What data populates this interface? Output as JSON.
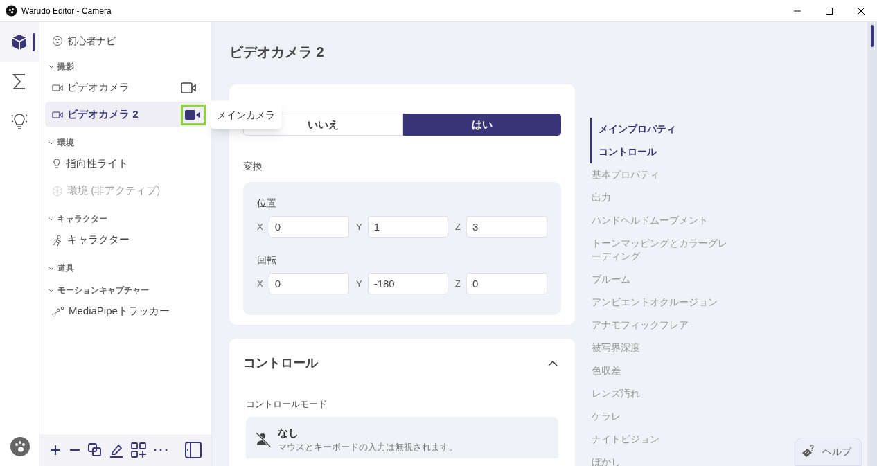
{
  "window": {
    "title": "Warudo Editor - Camera"
  },
  "rail": [
    {
      "kind": "cube",
      "selected": true
    },
    {
      "kind": "sigma",
      "selected": false
    },
    {
      "kind": "bulb",
      "selected": false
    }
  ],
  "tree": {
    "guide": "初心者ナビ",
    "groups": [
      {
        "label": "撮影",
        "expanded": true,
        "items": [
          {
            "label": "ビデオカメラ",
            "kind": "camera",
            "selected": false,
            "disabled": false,
            "main_camera": false
          },
          {
            "label": "ビデオカメラ 2",
            "kind": "camera",
            "selected": true,
            "disabled": false,
            "main_camera": true
          }
        ]
      },
      {
        "label": "環境",
        "expanded": true,
        "items": [
          {
            "label": "指向性ライト",
            "kind": "light",
            "selected": false,
            "disabled": false
          },
          {
            "label": "環境 (非アクティブ)",
            "kind": "environment",
            "selected": false,
            "disabled": true
          }
        ]
      },
      {
        "label": "キャラクター",
        "expanded": true,
        "items": [
          {
            "label": "キャラクター",
            "kind": "character",
            "selected": false,
            "disabled": false
          }
        ]
      },
      {
        "label": "道具",
        "expanded": true
      },
      {
        "label": "モーションキャプチャー",
        "expanded": true,
        "items": [
          {
            "label": "MediaPipeトラッカー",
            "kind": "tracker",
            "selected": false,
            "disabled": false
          }
        ]
      }
    ]
  },
  "tooltip": "メインカメラ",
  "main": {
    "title": "ビデオカメラ 2",
    "toggle": [
      {
        "label": "いいえ",
        "selected": false
      },
      {
        "label": "はい",
        "selected": true
      }
    ],
    "transform": {
      "label": "変換",
      "groups": [
        {
          "label": "位置",
          "fields": [
            {
              "axis": "X",
              "value": "0"
            },
            {
              "axis": "Y",
              "value": "1"
            },
            {
              "axis": "Z",
              "value": "3"
            }
          ]
        },
        {
          "label": "回転",
          "fields": [
            {
              "axis": "X",
              "value": "0"
            },
            {
              "axis": "Y",
              "value": "-180"
            },
            {
              "axis": "Z",
              "value": "0"
            }
          ]
        }
      ]
    },
    "control": {
      "title": "コントロール",
      "expanded": true,
      "mode_label": "コントロールモード",
      "option": {
        "title": "なし",
        "description": "マウスとキーボードの入力は無視されます。"
      }
    }
  },
  "nav": [
    {
      "label": "メインプロパティ",
      "selected": true
    },
    {
      "label": "コントロール",
      "selected": true
    },
    {
      "label": "基本プロパティ",
      "selected": false
    },
    {
      "label": "出力",
      "selected": false
    },
    {
      "label": "ハンドヘルドムーブメント",
      "selected": false
    },
    {
      "label": "トーンマッピングとカラーグレーディング",
      "selected": false
    },
    {
      "label": "ブルーム",
      "selected": false
    },
    {
      "label": "アンビエントオクルージョン",
      "selected": false
    },
    {
      "label": "アナモフィックフレア",
      "selected": false
    },
    {
      "label": "被写界深度",
      "selected": false
    },
    {
      "label": "色収差",
      "selected": false
    },
    {
      "label": "レンズ汚れ",
      "selected": false
    },
    {
      "label": "ケラレ",
      "selected": false
    },
    {
      "label": "ナイトビジョン",
      "selected": false
    },
    {
      "label": "ぼかし",
      "selected": false
    }
  ],
  "help": "ヘルプ"
}
